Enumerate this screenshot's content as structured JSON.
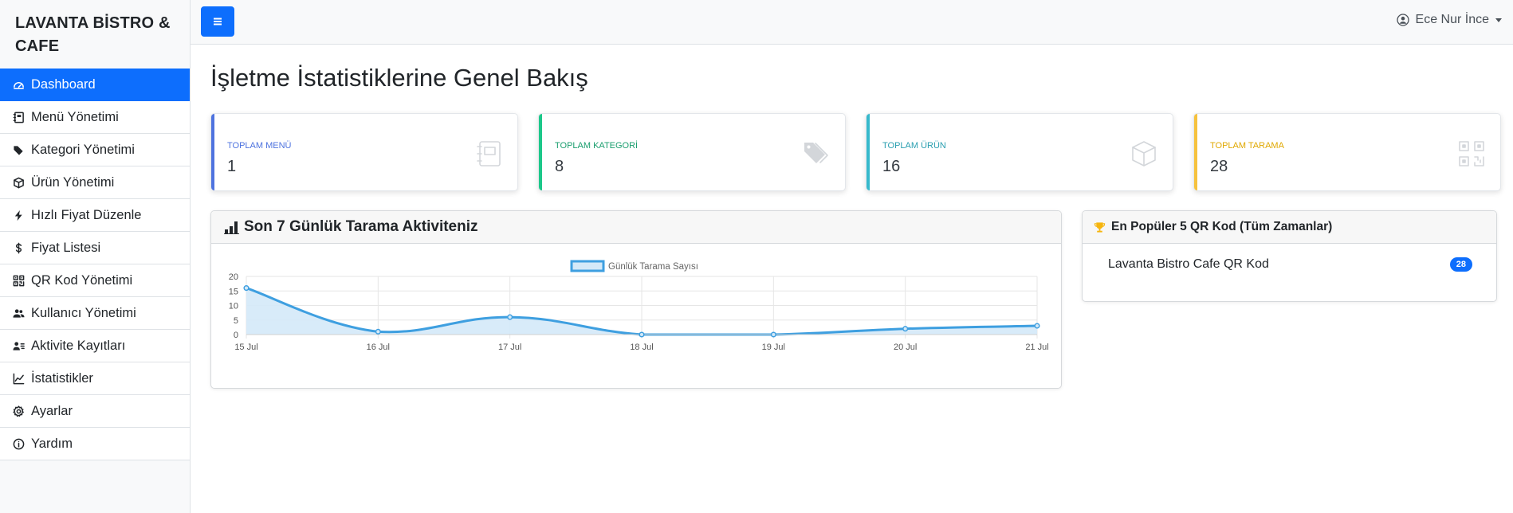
{
  "brand": {
    "name": "LAVANTA BİSTRO & CAFE"
  },
  "sidebar": {
    "items": [
      {
        "label": "Dashboard",
        "icon": "dashboard-icon",
        "active": true
      },
      {
        "label": "Menü Yönetimi",
        "icon": "journal-icon"
      },
      {
        "label": "Kategori Yönetimi",
        "icon": "tags-icon"
      },
      {
        "label": "Ürün Yönetimi",
        "icon": "box-icon"
      },
      {
        "label": "Hızlı Fiyat Düzenle",
        "icon": "lightning-icon"
      },
      {
        "label": "Fiyat Listesi",
        "icon": "dollar-icon"
      },
      {
        "label": "QR Kod Yönetimi",
        "icon": "qr-code-icon"
      },
      {
        "label": "Kullanıcı Yönetimi",
        "icon": "users-icon"
      },
      {
        "label": "Aktivite Kayıtları",
        "icon": "person-lines-icon"
      },
      {
        "label": "İstatistikler",
        "icon": "graph-up-icon"
      },
      {
        "label": "Ayarlar",
        "icon": "gear-icon"
      },
      {
        "label": "Yardım",
        "icon": "info-circle-icon"
      }
    ]
  },
  "topbar": {
    "user_name": "Ece Nur İnce"
  },
  "main": {
    "title": "İşletme İstatistiklerine Genel Bakış",
    "stats": [
      {
        "label": "TOPLAM MENÜ",
        "value": "1",
        "color": "#4e73df",
        "icon": "journal-icon"
      },
      {
        "label": "TOPLAM KATEGORİ",
        "value": "8",
        "color": "#1cc88a",
        "icon": "tags-icon"
      },
      {
        "label": "TOPLAM ÜRÜN",
        "value": "16",
        "color": "#36b9cc",
        "icon": "box-icon"
      },
      {
        "label": "TOPLAM TARAMA",
        "value": "28",
        "color": "#f6c23e",
        "icon": "qr-code-icon"
      }
    ],
    "activity_card": {
      "title": "Son 7 Günlük Tarama Aktiviteniz"
    },
    "popular_card": {
      "title": "En Popüler 5 QR Kod (Tüm Zamanlar)",
      "items": [
        {
          "name": "Lavanta Bistro Cafe QR Kod",
          "count": "28"
        }
      ]
    }
  },
  "chart_data": {
    "type": "area",
    "categories": [
      "15 Jul",
      "16 Jul",
      "17 Jul",
      "18 Jul",
      "19 Jul",
      "20 Jul",
      "21 Jul"
    ],
    "series": [
      {
        "name": "Günlük Tarama Sayısı",
        "values": [
          16,
          1,
          6,
          0,
          0,
          2,
          3
        ]
      }
    ],
    "ylim": [
      0,
      20
    ],
    "yticks": [
      0,
      5,
      10,
      15,
      20
    ],
    "grid": true,
    "legend": "top-center",
    "line_color": "#3e9fe0",
    "fill_color": "#d4e9f8"
  }
}
